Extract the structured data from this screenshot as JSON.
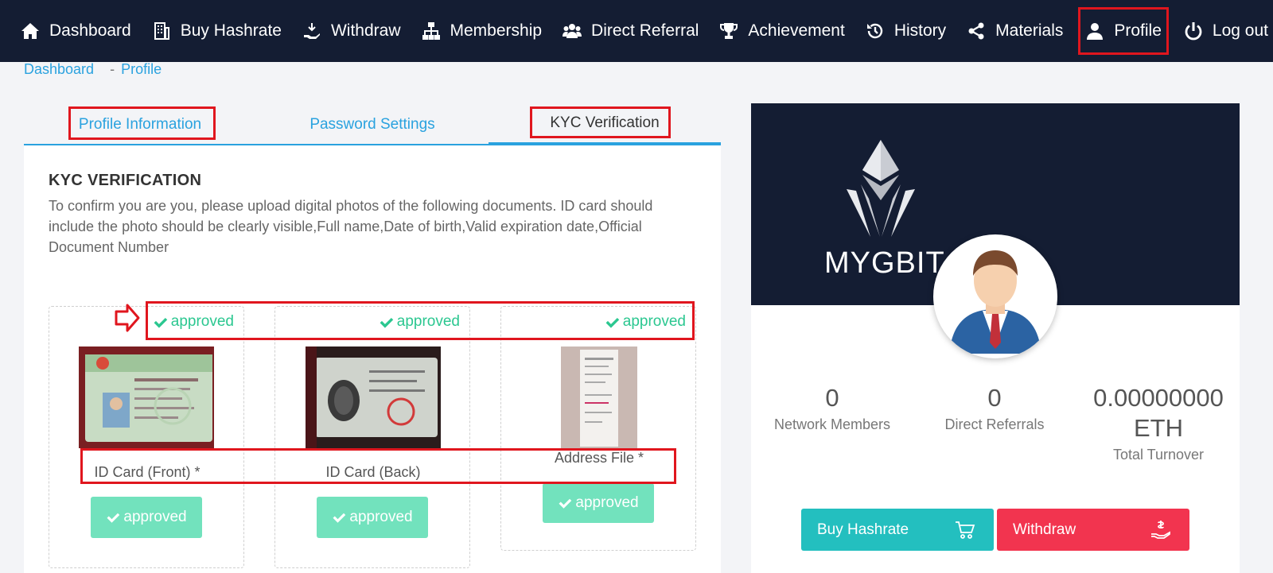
{
  "nav": {
    "items": [
      {
        "label": "Dashboard",
        "icon": "home-icon"
      },
      {
        "label": "Buy Hashrate",
        "icon": "building-icon"
      },
      {
        "label": "Withdraw",
        "icon": "hand-coin-icon"
      },
      {
        "label": "Membership",
        "icon": "sitemap-icon"
      },
      {
        "label": "Direct Referral",
        "icon": "users-icon"
      },
      {
        "label": "Achievement",
        "icon": "trophy-icon"
      },
      {
        "label": "History",
        "icon": "history-icon"
      },
      {
        "label": "Materials",
        "icon": "share-icon"
      },
      {
        "label": "Profile",
        "icon": "user-icon"
      },
      {
        "label": "Log out",
        "icon": "power-icon"
      }
    ],
    "active": "Profile"
  },
  "breadcrumb": {
    "home": "Dashboard",
    "sep": "-",
    "current": "Profile"
  },
  "tabs": {
    "profile": "Profile Information",
    "password": "Password Settings",
    "kyc": "KYC Verification"
  },
  "kyc": {
    "title": "KYC VERIFICATION",
    "description": "To confirm you are you, please upload digital photos of the following documents. ID card should include the photo should be clearly visible,Full name,Date of birth,Valid expiration date,Official Document Number",
    "documents": [
      {
        "status": "approved",
        "label": "ID Card (Front) *",
        "button": "approved"
      },
      {
        "status": "approved",
        "label": "ID Card (Back)",
        "button": "approved"
      },
      {
        "status": "approved",
        "label": "Address File *",
        "button": "approved"
      }
    ]
  },
  "profile": {
    "brand": "MYGBIT",
    "stats": [
      {
        "value": "0",
        "label": "Network Members"
      },
      {
        "value": "0",
        "label": "Direct Referrals"
      },
      {
        "value": "0.00000000 ETH",
        "label": "Total Turnover"
      }
    ],
    "buy_button": "Buy Hashrate",
    "withdraw_button": "Withdraw",
    "colors": {
      "buy": "#23bfbf",
      "withdraw": "#f2344f",
      "banner": "#141d33"
    }
  }
}
